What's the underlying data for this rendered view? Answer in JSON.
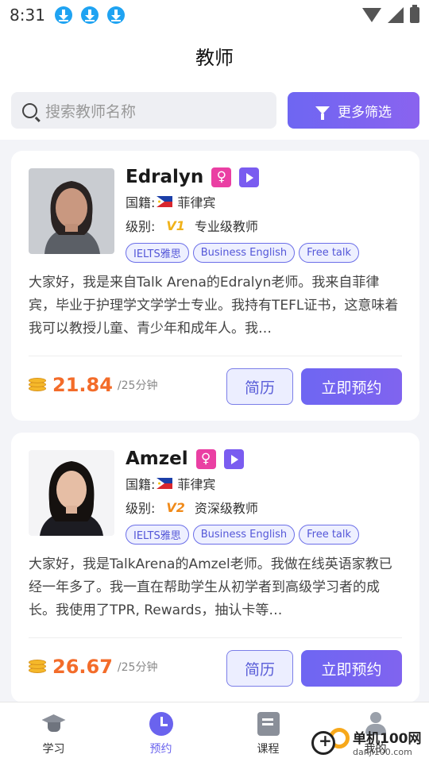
{
  "status_bar": {
    "time": "8:31",
    "icons": [
      "download-icon",
      "download-icon",
      "download-icon",
      "wifi-icon",
      "signal-icon",
      "battery-icon"
    ]
  },
  "header": {
    "title": "教师"
  },
  "search": {
    "placeholder": "搜索教师名称",
    "filter_label": "更多筛选"
  },
  "teachers": [
    {
      "name": "Edralyn",
      "gender_symbol": "♀",
      "nationality_label": "国籍:",
      "nationality": "菲律宾",
      "level_label": "级别:",
      "level_badge": "V1",
      "level": "专业级教师",
      "tags": [
        "IELTS雅思",
        "Business English",
        "Free talk"
      ],
      "intro": "大家好，我是来自Talk Arena的Edralyn老师。我来自菲律宾，毕业于护理学文学学士专业。我持有TEFL证书，这意味着我可以教授儿童、青少年和成年人。我…",
      "price": "21.84",
      "price_unit": "/25分钟",
      "resume_label": "简历",
      "book_label": "立即预约"
    },
    {
      "name": "Amzel",
      "gender_symbol": "♀",
      "nationality_label": "国籍:",
      "nationality": "菲律宾",
      "level_label": "级别:",
      "level_badge": "V2",
      "level": "资深级教师",
      "tags": [
        "IELTS雅思",
        "Business English",
        "Free talk"
      ],
      "intro": "大家好，我是TalkArena的Amzel老师。我做在线英语家教已经一年多了。我一直在帮助学生从初学者到高级学习者的成长。我使用了TPR, Rewards，抽认卡等…",
      "price": "26.67",
      "price_unit": "/25分钟",
      "resume_label": "简历",
      "book_label": "立即预约"
    }
  ],
  "bottom_nav": [
    {
      "label": "学习",
      "icon": "graduation-cap-icon",
      "active": false
    },
    {
      "label": "预约",
      "icon": "clock-icon",
      "active": true
    },
    {
      "label": "课程",
      "icon": "course-icon",
      "active": false
    },
    {
      "label": "我的",
      "icon": "person-icon",
      "active": false
    }
  ],
  "watermark": {
    "title": "单机100网",
    "url": "danji100.com"
  },
  "colors": {
    "accent": "#6a63ee",
    "price": "#f36c2a",
    "gender": "#ea3fa3"
  }
}
